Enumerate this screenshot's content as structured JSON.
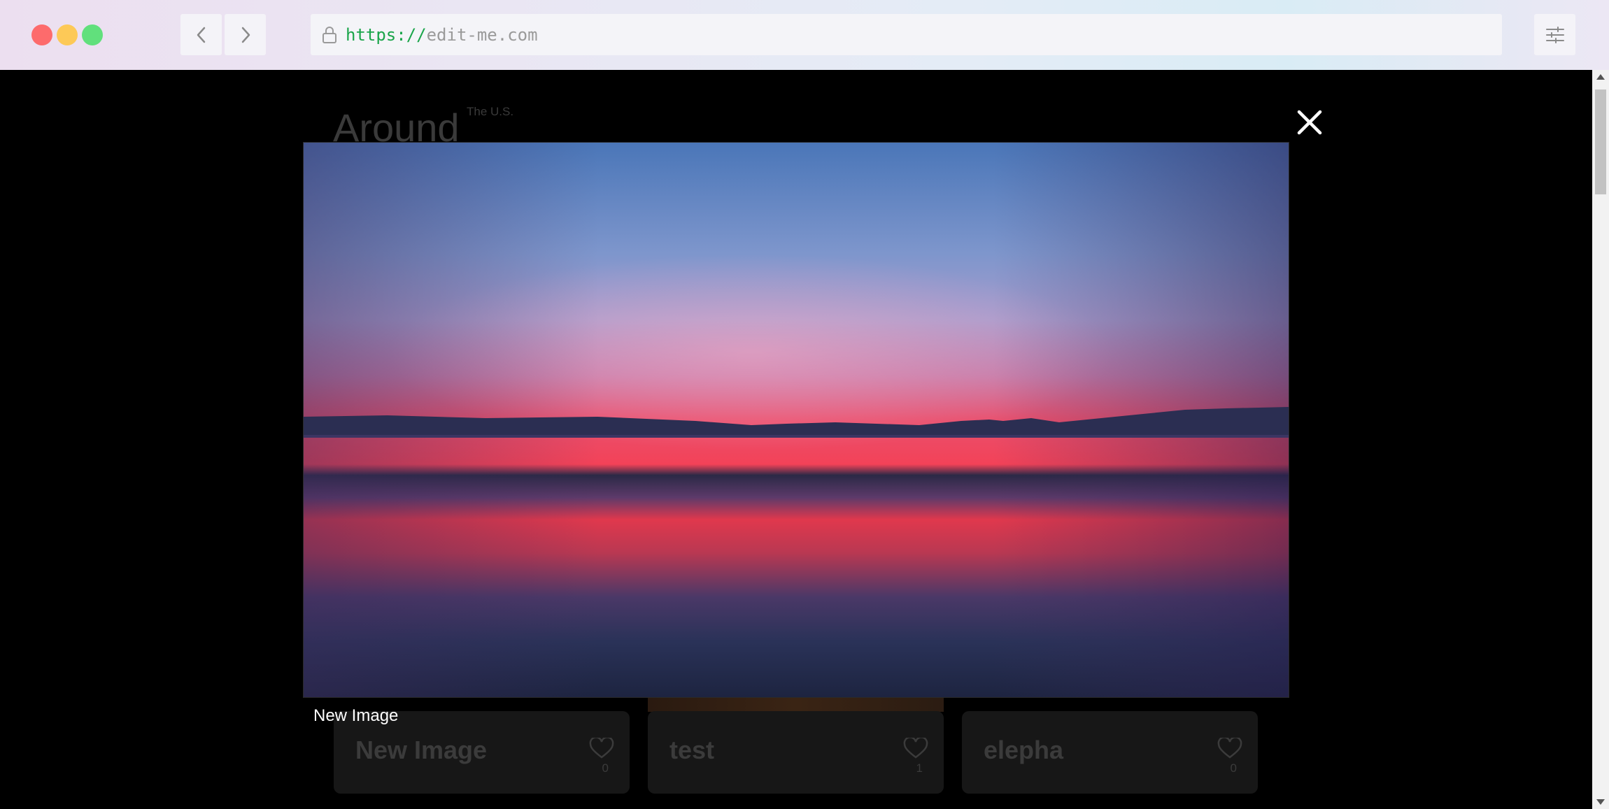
{
  "browser": {
    "url_scheme": "https://",
    "url_host": "edit-me.com",
    "window_controls": {
      "close_color": "#fd6b6c",
      "minimize_color": "#fdc957",
      "maximize_color": "#61e07c"
    },
    "icons": {
      "back": "chevron-left-icon",
      "forward": "chevron-right-icon",
      "lock": "lock-icon",
      "settings": "sliders-icon"
    }
  },
  "page": {
    "title": "Around",
    "subtitle": "The U.S.",
    "cards": [
      {
        "title": "New Image",
        "likes": "0"
      },
      {
        "title": "test",
        "likes": "1"
      },
      {
        "title": "elepha",
        "likes": "0"
      }
    ]
  },
  "modal": {
    "caption": "New Image",
    "close_icon": "close-icon"
  }
}
